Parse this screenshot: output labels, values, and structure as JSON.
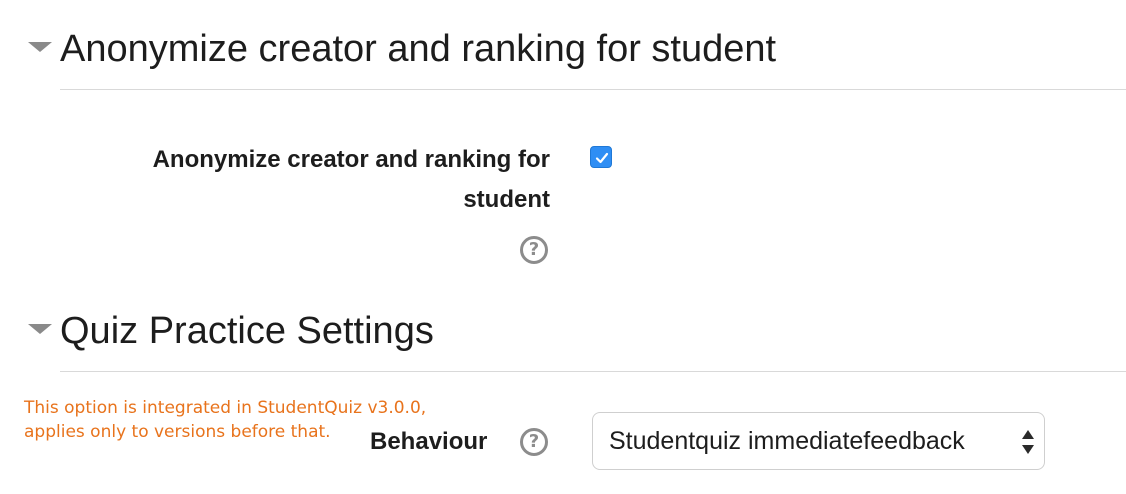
{
  "sections": [
    {
      "title": "Anonymize creator and ranking for student",
      "fields": [
        {
          "label_line1": "Anonymize creator and ranking for",
          "label_line2": "student",
          "checked": true,
          "help_icon": "question-circle-icon"
        }
      ]
    },
    {
      "title": "Quiz Practice Settings",
      "note": {
        "line1": "This option is integrated in StudentQuiz v3.0.0,",
        "line2": "applies only to versions before that."
      },
      "fields": [
        {
          "label": "Behaviour",
          "help_icon": "question-circle-icon",
          "select_value": "Studentquiz immediatefeedback"
        }
      ]
    }
  ],
  "colors": {
    "note": "#e8731c",
    "checkbox": "#2f8ef4",
    "caret": "#8a8a8a"
  }
}
